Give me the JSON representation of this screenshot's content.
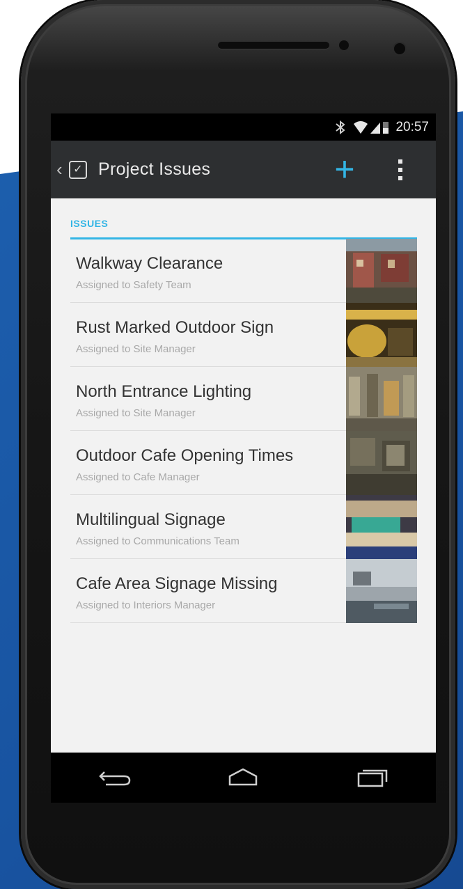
{
  "statusbar": {
    "time": "20:57"
  },
  "actionbar": {
    "title": "Project Issues",
    "accent": "#33b5e5"
  },
  "section": {
    "header": "ISSUES"
  },
  "issues": [
    {
      "title": "Walkway Clearance",
      "subtitle": "Assigned to Safety Team"
    },
    {
      "title": "Rust Marked Outdoor Sign",
      "subtitle": "Assigned to Site Manager"
    },
    {
      "title": "North Entrance Lighting",
      "subtitle": "Assigned to Site Manager"
    },
    {
      "title": "Outdoor Cafe Opening Times",
      "subtitle": "Assigned to Cafe Manager"
    },
    {
      "title": "Multilingual Signage",
      "subtitle": "Assigned to Communications Team"
    },
    {
      "title": "Cafe Area Signage Missing",
      "subtitle": "Assigned to Interiors Manager"
    }
  ],
  "icons": {
    "back": "chevron-left-icon",
    "app": "checkbox-icon",
    "add": "plus-icon",
    "overflow": "overflow-menu-icon",
    "nav": [
      "back-icon",
      "home-icon",
      "recent-apps-icon"
    ]
  }
}
